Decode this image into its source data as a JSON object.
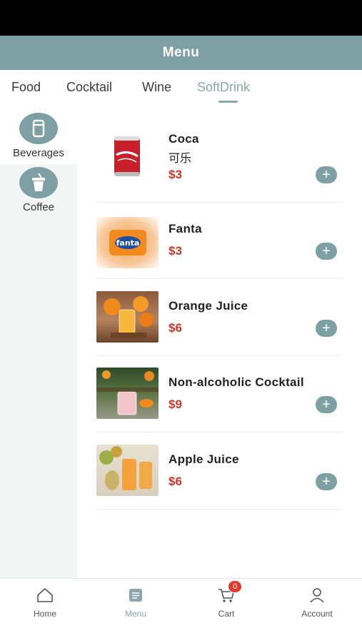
{
  "header": {
    "title": "Menu"
  },
  "tabs": [
    {
      "label": "Food",
      "active": false
    },
    {
      "label": "Cocktail",
      "active": false
    },
    {
      "label": "Wine",
      "active": false
    },
    {
      "label": "SoftDrink",
      "active": true
    }
  ],
  "sidebar": {
    "items": [
      {
        "label": "Beverages",
        "icon": "cup-icon",
        "active": true
      },
      {
        "label": "Coffee",
        "icon": "drink-lid-icon",
        "active": false
      }
    ]
  },
  "products": [
    {
      "name": "Coca",
      "subtitle": "可乐",
      "price": "$3",
      "image": "coca-can-image"
    },
    {
      "name": "Fanta",
      "subtitle": "",
      "price": "$3",
      "image": "fanta-can-image"
    },
    {
      "name": "Orange Juice",
      "subtitle": "",
      "price": "$6",
      "image": "orange-juice-image"
    },
    {
      "name": "Non-alcoholic Cocktail",
      "subtitle": "",
      "price": "$9",
      "image": "cocktail-image"
    },
    {
      "name": "Apple Juice",
      "subtitle": "",
      "price": "$6",
      "image": "apple-juice-image"
    }
  ],
  "bottom_nav": [
    {
      "label": "Home",
      "icon": "home-icon",
      "active": false
    },
    {
      "label": "Menu",
      "icon": "menu-icon",
      "active": true
    },
    {
      "label": "Cart",
      "icon": "cart-icon",
      "active": false,
      "badge": "0"
    },
    {
      "label": "Account",
      "icon": "account-icon",
      "active": false
    }
  ],
  "colors": {
    "accent": "#7e9fa4",
    "price": "#d0352b",
    "badge": "#e23b2f"
  }
}
